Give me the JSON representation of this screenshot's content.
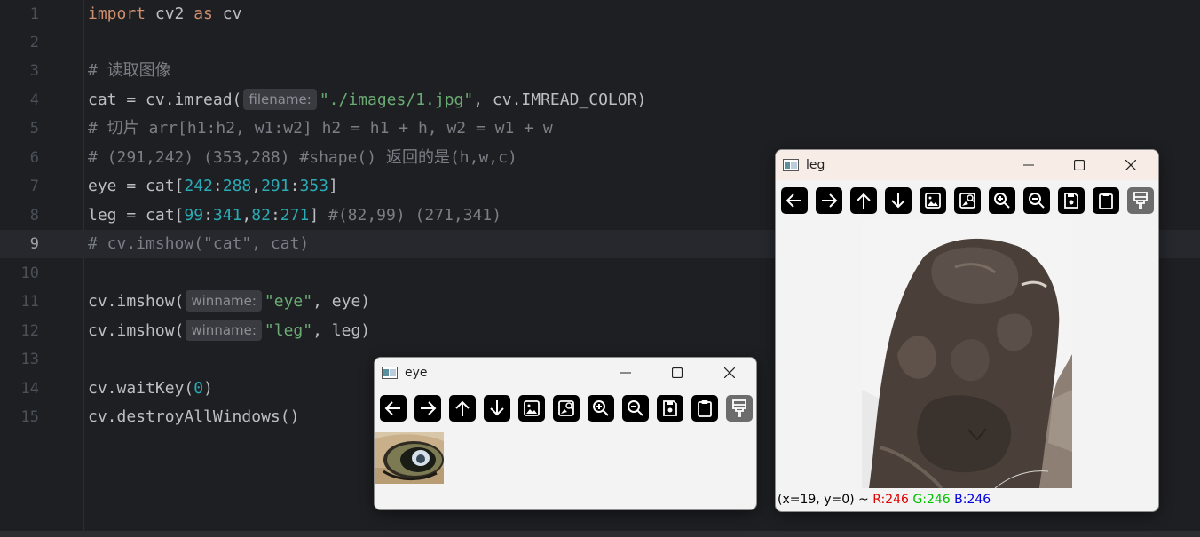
{
  "editor": {
    "lines": [
      {
        "n": "1"
      },
      {
        "n": "2"
      },
      {
        "n": "3"
      },
      {
        "n": "4"
      },
      {
        "n": "5"
      },
      {
        "n": "6"
      },
      {
        "n": "7"
      },
      {
        "n": "8"
      },
      {
        "n": "9"
      },
      {
        "n": "10"
      },
      {
        "n": "11"
      },
      {
        "n": "12"
      },
      {
        "n": "13"
      },
      {
        "n": "14"
      },
      {
        "n": "15"
      }
    ],
    "current_line": "9",
    "code": {
      "l1": {
        "kw1": "import",
        "t1": " cv2 ",
        "kw2": "as",
        "t2": " cv"
      },
      "l3": {
        "cmt": "# 读取图像"
      },
      "l4": {
        "t1": "cat = cv.imread(",
        "hint": "filename:",
        "str": "\"./images/1.jpg\"",
        "t2": ", cv.IMREAD_COLOR)"
      },
      "l5": {
        "cmt": "# 切片 arr[h1:h2, w1:w2] h2 = h1 + h, w2 = w1 + w"
      },
      "l6": {
        "cmt": "# (291,242) (353,288) #shape() 返回的是(h,w,c)"
      },
      "l7": {
        "t1": "eye = cat[",
        "n1": "242",
        "c1": ":",
        "n2": "288",
        "c2": ",",
        "n3": "291",
        "c3": ":",
        "n4": "353",
        "t2": "]"
      },
      "l8": {
        "t1": "leg = cat[",
        "n1": "99",
        "c1": ":",
        "n2": "341",
        "c2": ",",
        "n3": "82",
        "c3": ":",
        "n4": "271",
        "t2": "] ",
        "cmt": "#(82,99) (271,341)"
      },
      "l9": {
        "cmt": "# cv.imshow(\"cat\", cat)"
      },
      "l11": {
        "t1": "cv.imshow(",
        "hint": "winname:",
        "str": "\"eye\"",
        "t2": ", eye)"
      },
      "l12": {
        "t1": "cv.imshow(",
        "hint": "winname:",
        "str": "\"leg\"",
        "t2": ", leg)"
      },
      "l14": {
        "t1": "cv.waitKey(",
        "num": "0",
        "t2": ")"
      },
      "l15": {
        "t1": "cv.destroyAllWindows()"
      }
    }
  },
  "windows": {
    "eye": {
      "title": "eye"
    },
    "leg": {
      "title": "leg",
      "status": {
        "coords": "(x=19, y=0) ~ ",
        "r": "R:246",
        "g": "G:246",
        "b": "B:246"
      }
    }
  },
  "toolbar_icons": [
    "arrow-left-icon",
    "arrow-right-icon",
    "arrow-up-icon",
    "arrow-down-icon",
    "image-icon",
    "image-zoom-icon",
    "zoom-in-icon",
    "zoom-out-icon",
    "save-icon",
    "clipboard-icon",
    "paintbrush-icon"
  ],
  "colors": {
    "editor_bg": "#1e1f22",
    "keyword": "#cf8e6d",
    "string": "#6aab73",
    "number": "#2aacb8",
    "comment": "#7a7e85",
    "text": "#bcbec4"
  }
}
